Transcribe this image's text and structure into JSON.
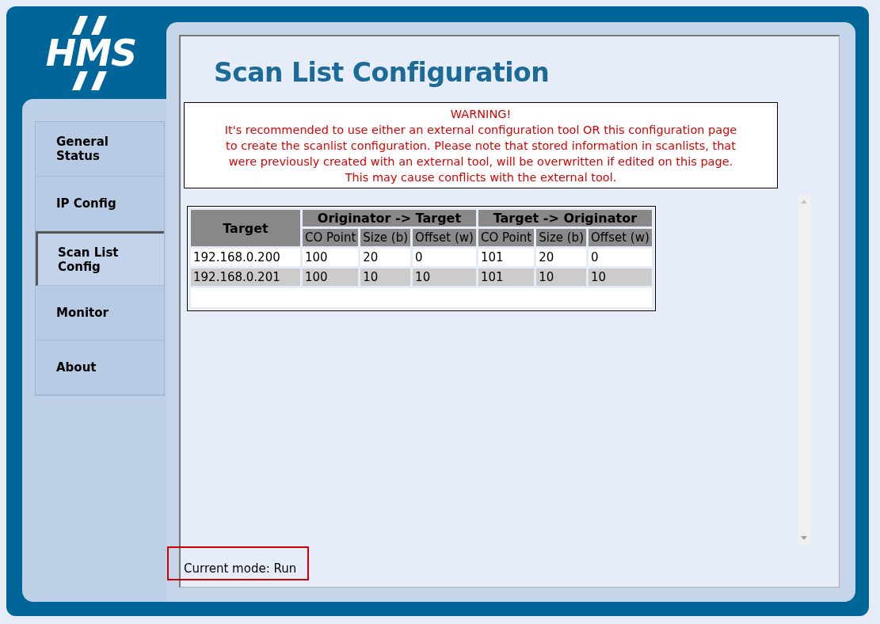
{
  "logo": {
    "text": "HMS"
  },
  "nav": {
    "items": [
      {
        "label": "General Status",
        "selected": false
      },
      {
        "label": "IP Config",
        "selected": false
      },
      {
        "label": "Scan List Config",
        "selected": true
      },
      {
        "label": "Monitor",
        "selected": false
      },
      {
        "label": "About",
        "selected": false
      }
    ]
  },
  "page": {
    "title": "Scan List Configuration"
  },
  "warning": {
    "heading": "WARNING!",
    "lines": [
      "It's recommended to use either an external configuration tool OR this configuration page",
      "to create the scanlist configuration. Please note that stored information in scanlists, that",
      "were previously created with an external tool, will be overwritten if edited on this page.",
      "This may cause conflicts with the external tool."
    ]
  },
  "table": {
    "first_column": "Target",
    "groups": [
      {
        "label": "Originator -> Target",
        "columns": [
          "CO Point",
          "Size (b)",
          "Offset (w)"
        ]
      },
      {
        "label": "Target -> Originator",
        "columns": [
          "CO Point",
          "Size (b)",
          "Offset (w)"
        ]
      }
    ],
    "rows": [
      [
        "192.168.0.200",
        "100",
        "20",
        "0",
        "101",
        "20",
        "0"
      ],
      [
        "192.168.0.201",
        "100",
        "10",
        "10",
        "101",
        "10",
        "10"
      ]
    ]
  },
  "status": {
    "text": "Current mode: Run",
    "highlighted": true
  }
}
